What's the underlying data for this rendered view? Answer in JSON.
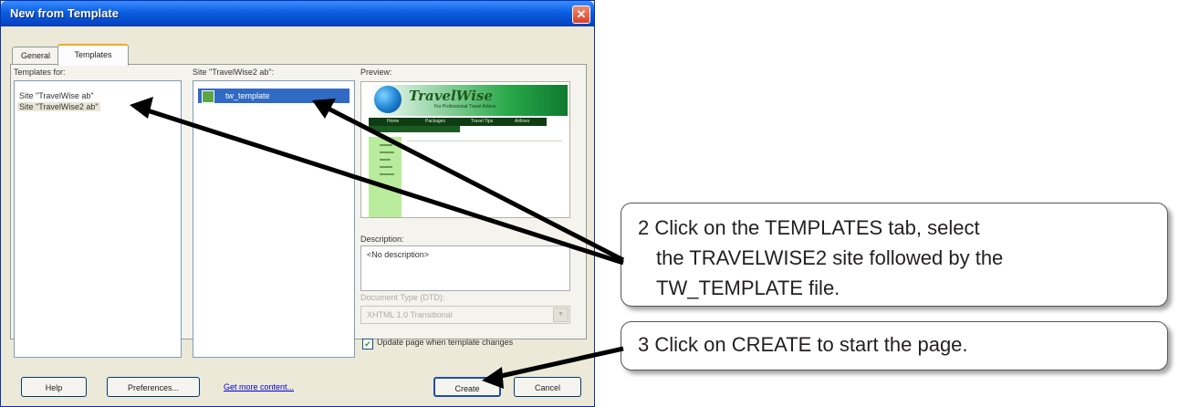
{
  "dialog": {
    "title": "New from Template",
    "close_glyph": "✕",
    "tabs": [
      "General",
      "Templates"
    ],
    "templates_for_label": "Templates for:",
    "sites": [
      "Site \"TravelWise ab\"",
      "Site \"TravelWise2 ab\""
    ],
    "site_templates_label": "Site \"TravelWise2 ab\":",
    "templates": [
      "tw_template"
    ],
    "preview_label": "Preview:",
    "preview": {
      "logo": "TravelWise",
      "tagline": "For Professional Travel Advice",
      "nav": [
        "Home",
        "Packages",
        "Travel Tips",
        "Airlines"
      ]
    },
    "description_label": "Description:",
    "description_value": "<No description>",
    "doc_type_label": "Document Type (DTD):",
    "doc_type_value": "XHTML 1.0 Transitional",
    "update_checkbox_label": "Update page when template changes",
    "update_checked": true,
    "buttons": {
      "help": "Help",
      "preferences": "Preferences...",
      "create": "Create",
      "cancel": "Cancel"
    },
    "more_content_link": "Get more content..."
  },
  "callouts": {
    "step2_line1": "2  Click on the TEMPLATES tab, select",
    "step2_line2": "the TRAVELWISE2 site followed by the",
    "step2_line3": "TW_TEMPLATE file.",
    "step3": "3  Click on CREATE to start the page."
  },
  "colors": {
    "titlebar": "#0a5fe0",
    "selection": "#316ac5",
    "dialog_bg": "#ece9d8",
    "arrow": "#000000"
  }
}
